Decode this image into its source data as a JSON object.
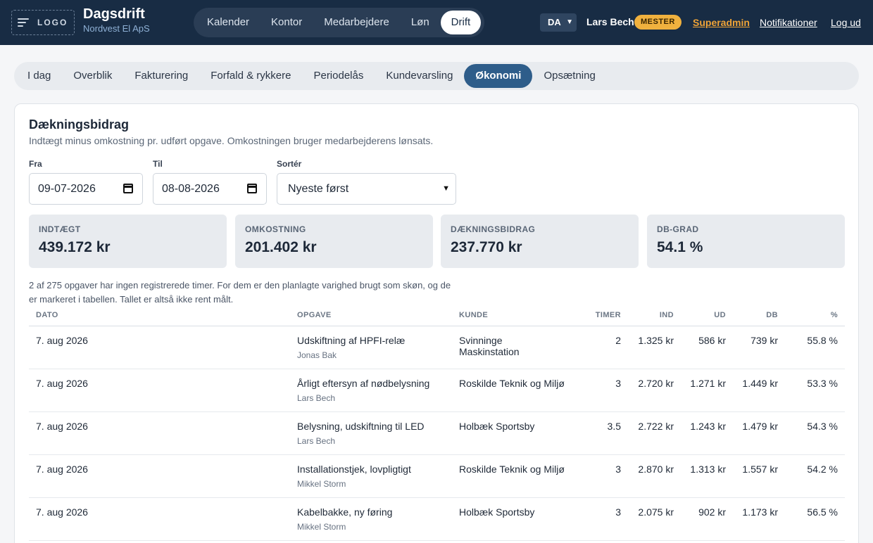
{
  "header": {
    "logo_text": "LOGO",
    "app_title": "Dagsdrift",
    "company": "Nordvest El ApS",
    "nav": [
      "Kalender",
      "Kontor",
      "Medarbejdere",
      "Løn",
      "Drift"
    ],
    "active_nav": "Drift",
    "language": "DA",
    "user_name": "Lars Bech",
    "user_role": "MESTER",
    "links": {
      "superadmin": "Superadmin",
      "notifications": "Notifikationer",
      "logout": "Log ud"
    }
  },
  "subtabs": [
    "I dag",
    "Overblik",
    "Fakturering",
    "Forfald & rykkere",
    "Periodelås",
    "Kundevarsling",
    "Økonomi",
    "Opsætning"
  ],
  "active_subtab": "Økonomi",
  "section": {
    "title": "Dækningsbidrag",
    "description": "Indtægt minus omkostning pr. udført opgave. Omkostningen bruger medarbejderens lønsats."
  },
  "filters": {
    "from_label": "Fra",
    "from_value": "09-07-2026",
    "to_label": "Til",
    "to_value": "08-08-2026",
    "sort_label": "Sortér",
    "sort_value": "Nyeste først"
  },
  "stats": [
    {
      "label": "INDTÆGT",
      "value": "439.172 kr"
    },
    {
      "label": "OMKOSTNING",
      "value": "201.402 kr"
    },
    {
      "label": "DÆKNINGSBIDRAG",
      "value": "237.770 kr"
    },
    {
      "label": "DB-GRAD",
      "value": "54.1 %"
    }
  ],
  "note_line1": "2 af 275 opgaver har ingen registrerede timer. For dem er den planlagte varighed brugt som skøn, og de",
  "note_line2": "er markeret i tabellen. Tallet er altså ikke rent målt.",
  "table": {
    "columns": [
      "DATO",
      "OPGAVE",
      "KUNDE",
      "TIMER",
      "IND",
      "UD",
      "DB",
      "%"
    ],
    "rows": [
      {
        "date": "7. aug 2026",
        "task": "Udskiftning af HPFI-relæ",
        "employee": "Jonas Bak",
        "customer": "Svinninge Maskinstation",
        "hours": "2",
        "income": "1.325 kr",
        "cost": "586 kr",
        "db": "739 kr",
        "pct": "55.8 %"
      },
      {
        "date": "7. aug 2026",
        "task": "Årligt eftersyn af nødbelysning",
        "employee": "Lars Bech",
        "customer": "Roskilde Teknik og Miljø",
        "hours": "3",
        "income": "2.720 kr",
        "cost": "1.271 kr",
        "db": "1.449 kr",
        "pct": "53.3 %"
      },
      {
        "date": "7. aug 2026",
        "task": "Belysning, udskiftning til LED",
        "employee": "Lars Bech",
        "customer": "Holbæk Sportsby",
        "hours": "3.5",
        "income": "2.722 kr",
        "cost": "1.243 kr",
        "db": "1.479 kr",
        "pct": "54.3 %"
      },
      {
        "date": "7. aug 2026",
        "task": "Installationstjek, lovpligtigt",
        "employee": "Mikkel Storm",
        "customer": "Roskilde Teknik og Miljø",
        "hours": "3",
        "income": "2.870 kr",
        "cost": "1.313 kr",
        "db": "1.557 kr",
        "pct": "54.2 %"
      },
      {
        "date": "7. aug 2026",
        "task": "Kabelbakke, ny føring",
        "employee": "Mikkel Storm",
        "customer": "Holbæk Sportsby",
        "hours": "3",
        "income": "2.075 kr",
        "cost": "902 kr",
        "db": "1.173 kr",
        "pct": "56.5 %"
      }
    ]
  }
}
